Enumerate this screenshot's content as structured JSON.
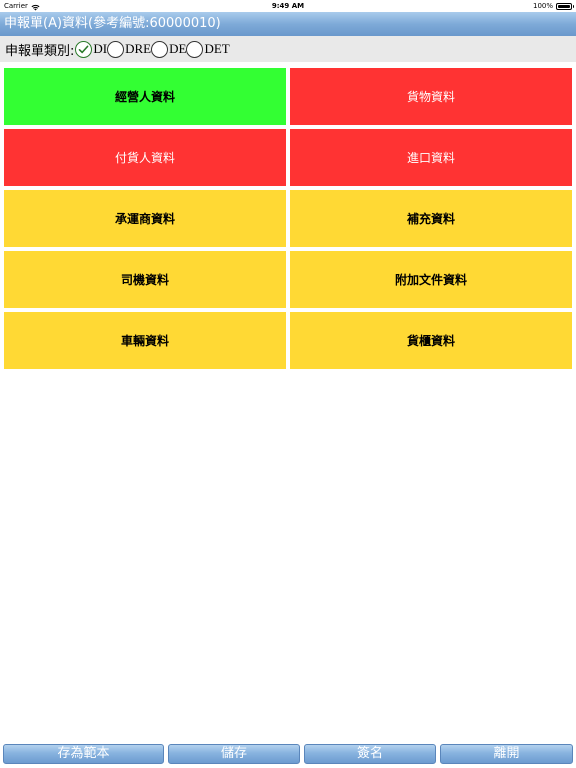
{
  "status_bar": {
    "carrier": "Carrier",
    "time": "9:49 AM",
    "battery": "100%",
    "wifi_icon": "wifi-icon",
    "battery_icon": "battery-icon"
  },
  "title": "申報單(A)資料(參考編號:60000010)",
  "type_selector": {
    "label": "申報單類別:",
    "options": [
      {
        "label": "DI",
        "checked": true
      },
      {
        "label": "DRE",
        "checked": false
      },
      {
        "label": "DE",
        "checked": false
      },
      {
        "label": "DET",
        "checked": false
      }
    ]
  },
  "colors": {
    "green": "#33ff33",
    "red": "#ff3333",
    "yellow": "#ffd934",
    "title_bar": "#7eaad8"
  },
  "tiles": [
    {
      "label": "經營人資料",
      "color": "green"
    },
    {
      "label": "貨物資料",
      "color": "red"
    },
    {
      "label": "付貨人資料",
      "color": "red"
    },
    {
      "label": "進口資料",
      "color": "red"
    },
    {
      "label": "承運商資料",
      "color": "yellow"
    },
    {
      "label": "補充資料",
      "color": "yellow"
    },
    {
      "label": "司機資料",
      "color": "yellow"
    },
    {
      "label": "附加文件資料",
      "color": "yellow"
    },
    {
      "label": "車輛資料",
      "color": "yellow"
    },
    {
      "label": "貨櫃資料",
      "color": "yellow"
    }
  ],
  "toolbar": {
    "save_template": "存為範本",
    "save": "儲存",
    "sign": "簽名",
    "exit": "離開"
  }
}
